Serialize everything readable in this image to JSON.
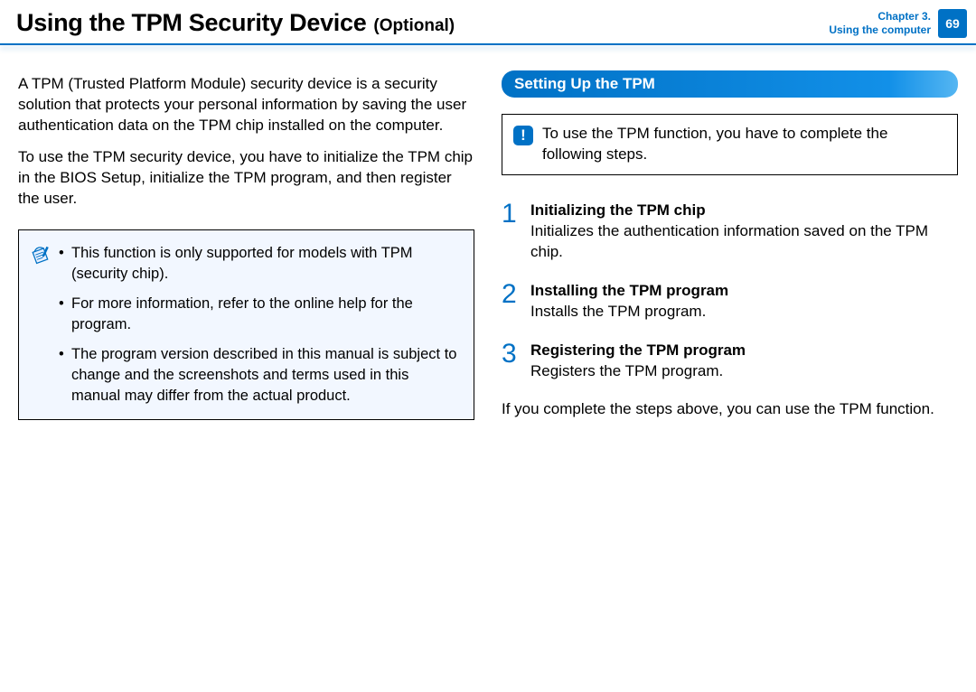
{
  "header": {
    "title_main": "Using the TPM Security Device",
    "title_suffix": "(Optional)",
    "chapter_line1": "Chapter 3.",
    "chapter_line2": "Using the computer",
    "page_number": "69"
  },
  "left": {
    "intro1": "A TPM (Trusted Platform Module) security device is a security solution that protects your personal information by saving the user authentication data on the TPM chip installed on the computer.",
    "intro2": "To use the TPM security device, you have to initialize the TPM chip in the BIOS Setup, initialize the TPM program, and then register the user.",
    "notes": [
      "This function is only supported for models with TPM (security chip).",
      "For more information, refer to the online help for the program.",
      "The program version described in this manual is subject to change and the screenshots and terms used in this manual may differ from the actual product."
    ]
  },
  "right": {
    "section_title": "Setting Up the TPM",
    "alert_text": "To use the TPM function, you have to complete the following steps.",
    "alert_glyph": "!",
    "steps": [
      {
        "num": "1",
        "title": "Initializing the TPM chip",
        "body": "Initializes the authentication information saved on the TPM chip."
      },
      {
        "num": "2",
        "title": "Installing the TPM program",
        "body": "Installs the TPM program."
      },
      {
        "num": "3",
        "title": "Registering the TPM program",
        "body": "Registers the TPM program."
      }
    ],
    "closing": "If you complete the steps above, you can use the TPM function."
  }
}
